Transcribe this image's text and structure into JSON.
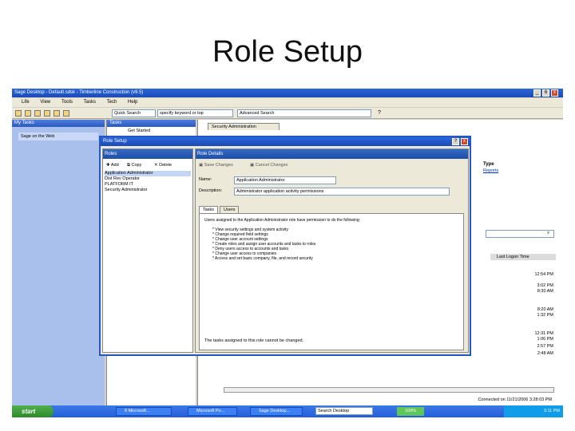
{
  "slide": {
    "title": "Role Setup"
  },
  "window": {
    "title": "Sage Desktop - Default.sdsk - Timberline Construction (v9.5)",
    "buttons": [
      "_",
      "6",
      "x"
    ]
  },
  "menu": [
    "Life",
    "View",
    "Tools",
    "Tasks",
    "Tech",
    "Help"
  ],
  "toolbar": {
    "quick_search": "Quick Search",
    "search_value": "specify keyword or top",
    "advanced_search": "Advanced Search"
  },
  "left_pane": {
    "header": "My Tasks",
    "item": "Sage on the Web"
  },
  "tasks_pane": {
    "header": "Tasks",
    "item": "Get Started"
  },
  "right_pane": {
    "tab": "Security Administration",
    "type_label": "Type",
    "type_link": "Reports",
    "column": "Last Logon Time",
    "times": [
      "12:54 PM",
      "3:02 PM",
      "8:30 AM",
      "8:20 AM",
      "1:32 PM",
      "12:31 PM",
      "1:06 PM",
      "2:57 PM",
      "2:48 AM"
    ],
    "status": "Connected on 11/21/2006 3:28:03 PM"
  },
  "dialog": {
    "title": "Role Setup",
    "roles_header": "Roles",
    "add": "Add",
    "copy": "Copy",
    "delete": "Delete",
    "roles": [
      "Application Administrator",
      "Dist Rev Operator",
      "PLATFORM IT",
      "Security Administrator"
    ],
    "details_header": "Role Details",
    "save": "Save Changes",
    "cancel": "Cancel Changes",
    "name_label": "Name:",
    "name_value": "Application Administrator",
    "description_label": "Description:",
    "description_value": "Administrator application activity permissions",
    "tab_tasks": "Tasks",
    "tab_users": "Users",
    "tasks_intro": "Users assigned to the Application Administrator role have permission to do the following:",
    "tasks_list": [
      "* View security settings and system activity",
      "* Change required field settings",
      "* Change user account settings",
      "* Create roles and assign user accounts and tasks to roles",
      "* Deny users access to accounts and tasks",
      "* Change user access to companies",
      "* Access and set basic company, file, and record security"
    ],
    "footer": "The tasks assigned to this role cannot be changed."
  },
  "taskbar": {
    "start": "start",
    "items": [
      "8 Microsoft...",
      "Microsoft Po...",
      "Sage Desktop..."
    ],
    "search": "Search Desktop",
    "zoom": "100%",
    "clock": "3:11 PM"
  }
}
